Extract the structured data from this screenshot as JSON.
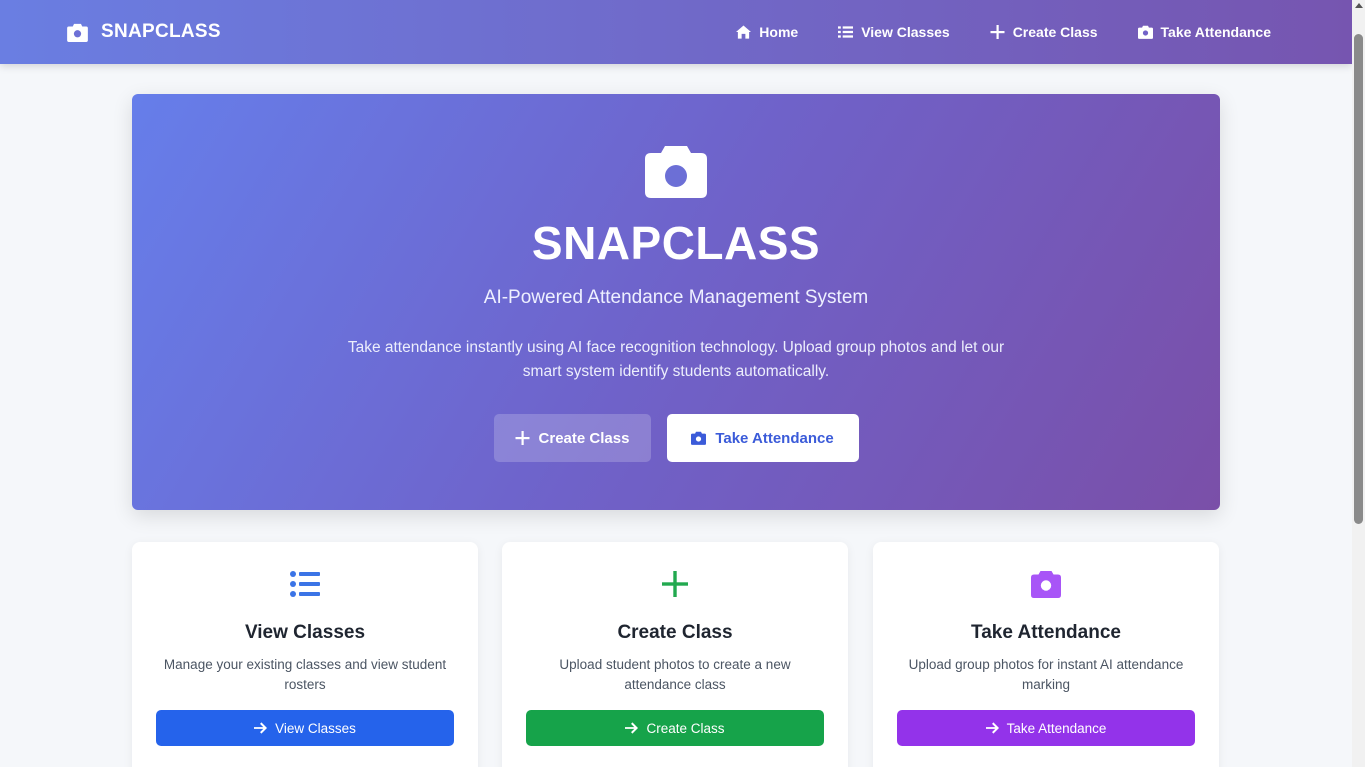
{
  "navbar": {
    "brand": "SNAPCLASS",
    "links": [
      {
        "label": "Home",
        "icon": "home-icon"
      },
      {
        "label": "View Classes",
        "icon": "list-icon"
      },
      {
        "label": "Create Class",
        "icon": "plus-icon"
      },
      {
        "label": "Take Attendance",
        "icon": "camera-icon"
      }
    ]
  },
  "hero": {
    "icon": "camera-icon",
    "title": "SNAPCLASS",
    "subtitle": "AI-Powered Attendance Management System",
    "description": "Take attendance instantly using AI face recognition technology. Upload group photos and let our smart system identify students automatically.",
    "primary_button": "Create Class",
    "secondary_button": "Take Attendance"
  },
  "cards": [
    {
      "icon": "list-icon",
      "title": "View Classes",
      "description": "Manage your existing classes and view student rosters",
      "button": "View Classes",
      "color": "#2563eb"
    },
    {
      "icon": "plus-icon",
      "title": "Create Class",
      "description": "Upload student photos to create a new attendance class",
      "button": "Create Class",
      "color": "#16a34a"
    },
    {
      "icon": "camera-icon",
      "title": "Take Attendance",
      "description": "Upload group photos for instant AI attendance marking",
      "button": "Take Attendance",
      "color": "#9333ea"
    }
  ],
  "colors": {
    "gradient_start": "#667eea",
    "gradient_end": "#764ba2",
    "page_background": "#f5f7fa",
    "hero_secondary_text": "#3b5bd9"
  }
}
